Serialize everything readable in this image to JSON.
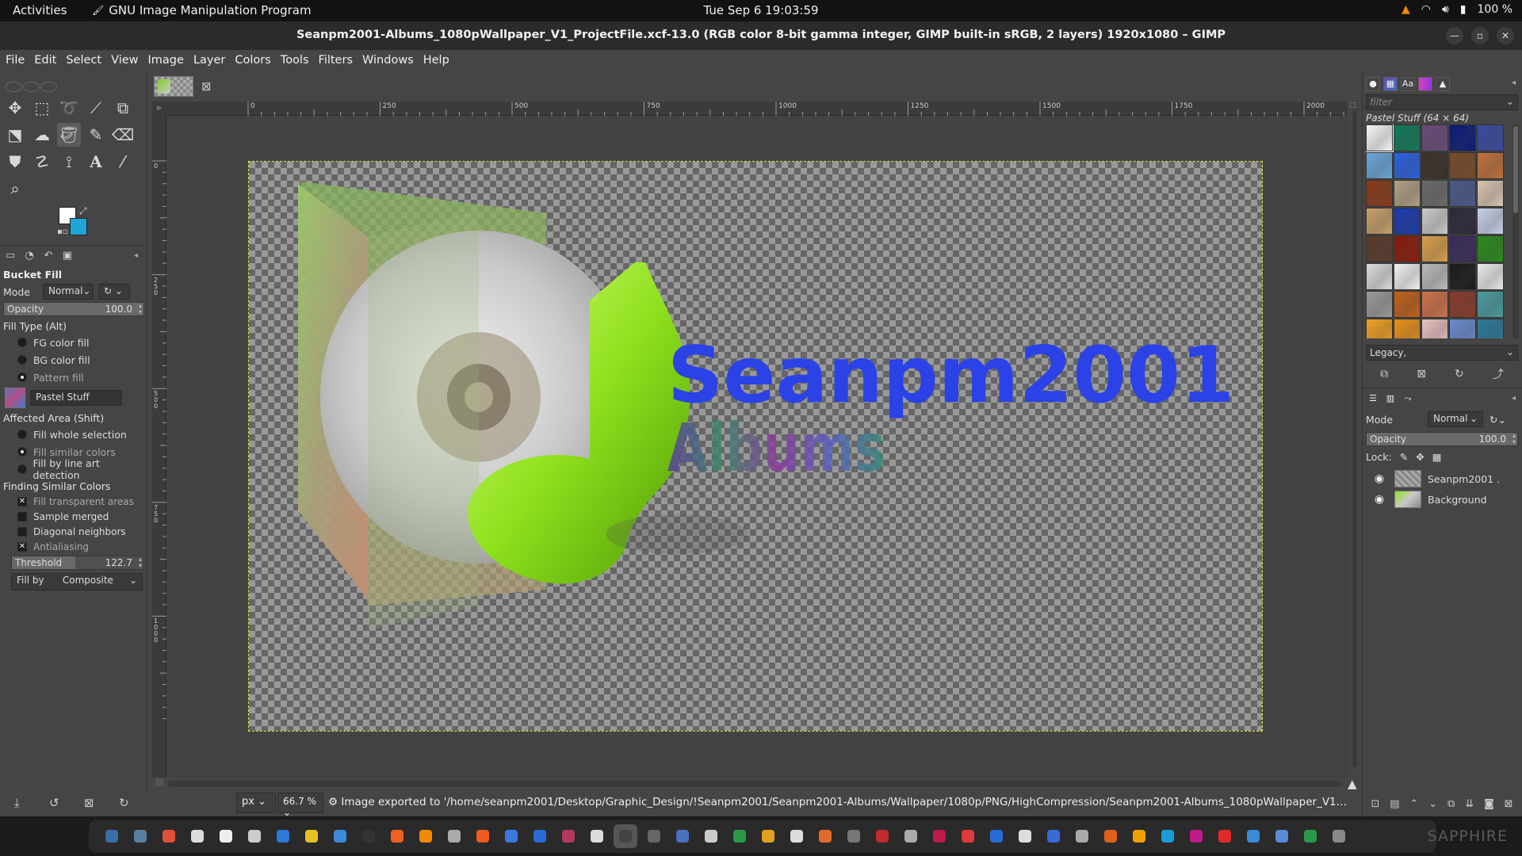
{
  "topbar": {
    "activities": "Activities",
    "app_name": "GNU Image Manipulation Program",
    "clock": "Tue Sep 6  19:03:59",
    "battery": "100 %"
  },
  "window": {
    "title": "Seanpm2001-Albums_1080pWallpaper_V1_ProjectFile.xcf-13.0 (RGB color 8-bit gamma integer, GIMP built-in sRGB, 2 layers) 1920x1080 – GIMP"
  },
  "menubar": [
    "File",
    "Edit",
    "Select",
    "View",
    "Image",
    "Layer",
    "Colors",
    "Tools",
    "Filters",
    "Windows",
    "Help"
  ],
  "colors": {
    "foreground": "#ffffff",
    "background": "#1fa6d8"
  },
  "tool_options": {
    "title": "Bucket Fill",
    "mode_label": "Mode",
    "mode_value": "Normal",
    "opacity_label": "Opacity",
    "opacity_value": "100.0",
    "fill_type_label": "Fill Type  (Alt)",
    "fill_types": [
      "FG color fill",
      "BG color fill",
      "Pattern fill"
    ],
    "pattern_name": "Pastel Stuff",
    "affected_area_label": "Affected Area  (Shift)",
    "affected_areas": [
      "Fill whole selection",
      "Fill similar colors",
      "Fill by line art detection"
    ],
    "finding_label": "Finding Similar Colors",
    "finding_options": [
      "Fill transparent areas",
      "Sample merged",
      "Diagonal neighbors",
      "Antialiasing"
    ],
    "threshold_label": "Threshold",
    "threshold_value": "122.7",
    "threshold_fraction": 0.48,
    "fill_by_label": "Fill by",
    "fill_by_value": "Composite"
  },
  "ruler": {
    "h_ticks": [
      "0",
      "250",
      "500",
      "750",
      "1000",
      "1250",
      "1500",
      "1750",
      "2000"
    ],
    "v_ticks": [
      "0",
      "2 5 0",
      "5 0 0",
      "7 5 0",
      "1 0 0 0"
    ]
  },
  "canvas_art": {
    "line1": "Seanpm2001",
    "line2": "Albums"
  },
  "statusbar": {
    "unit": "px",
    "zoom": "66.7 %",
    "message": "Image exported to '/home/seanpm2001/Desktop/Graphic_Design/!Seanpm2001/Seanpm2001-Albums/Wallpaper/1080p/PNG/HighCompression/Seanpm2001-Albums_1080pWallpaper_V1_..."
  },
  "patterns": {
    "filter_placeholder": "filter",
    "current": "Pastel Stuff (64 × 64)",
    "tag": "Legacy,"
  },
  "layers": {
    "mode_label": "Mode",
    "mode_value": "Normal",
    "opacity_label": "Opacity",
    "opacity_value": "100.0",
    "lock_label": "Lock:",
    "items": [
      "Seanpm2001 .",
      "Background"
    ]
  },
  "taskbar": {
    "brand": "SAPPHIRE"
  }
}
